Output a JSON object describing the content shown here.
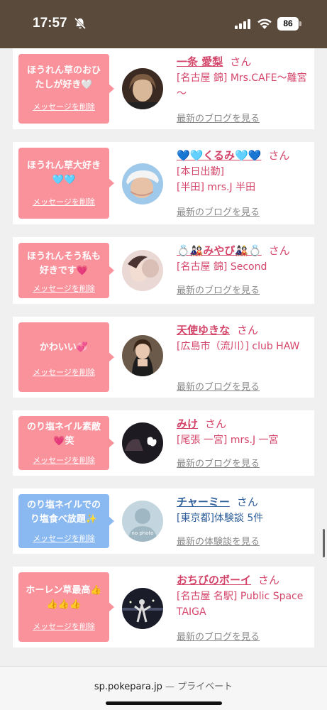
{
  "status_bar": {
    "time": "17:57",
    "battery": "86"
  },
  "cards": [
    {
      "message": "ほうれん草のおひたしが好き🤍",
      "delete_label": "メッセージを削除",
      "bubble_color": "#f9929b",
      "name": "一条 愛梨",
      "honorific": "さん",
      "shop": "[名古屋 錦] Mrs.CAFE～離宮～",
      "link": "最新のブログを見る"
    },
    {
      "message": "ほうれん草大好き🩵🩵",
      "delete_label": "メッセージを削除",
      "bubble_color": "#f9929b",
      "name": "💙🩵くるみ🩵💙",
      "honorific": "さん",
      "shop": "[本日出勤]",
      "shop2": "[半田] mrs.J 半田",
      "link": "最新のブログを見る"
    },
    {
      "message": "ほうれんそう私も好きです💗",
      "delete_label": "メッセージを削除",
      "bubble_color": "#f9929b",
      "name": "💍🎎みやび🎎💍",
      "honorific": "さん",
      "shop": "[名古屋 錦] Second",
      "link": "最新のブログを見る"
    },
    {
      "message": "かわいい💞",
      "delete_label": "メッセージを削除",
      "bubble_color": "#f9929b",
      "name": "天使ゆきな",
      "honorific": "さん",
      "shop": "[広島市（流川）] club HAW",
      "link": "最新のブログを見る"
    },
    {
      "message": "のり塩ネイル素敵💗笑",
      "delete_label": "メッセージを削除",
      "bubble_color": "#f9929b",
      "name": "みけ",
      "honorific": "さん",
      "shop": "[尾張 一宮] mrs.J 一宮",
      "link": "最新のブログを見る"
    },
    {
      "message": "のり塩ネイルでのり塩食べ放題✨",
      "delete_label": "メッセージを削除",
      "bubble_color": "#8ab8f0",
      "name": "チャーミー",
      "honorific": "さん",
      "shop": "[東京都]体験談 5件",
      "link": "最新の体験談を見る",
      "avatar_text": "no photo"
    },
    {
      "message": "ホーレン草最高👍👍👍👍",
      "delete_label": "メッセージを削除",
      "bubble_color": "#f9929b",
      "name": "おちびのボーイ",
      "honorific": "さん",
      "shop": "[名古屋 名駅] Public Space TAIGA",
      "link": "最新のブログを見る"
    }
  ],
  "browser": {
    "domain": "sp.pokepara.jp",
    "separator": "—",
    "mode": "プライベート"
  }
}
